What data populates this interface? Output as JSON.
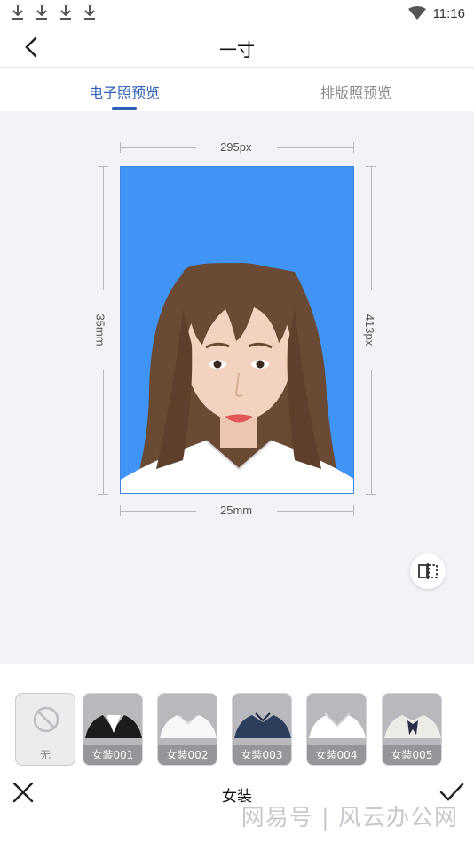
{
  "status_bar": {
    "time": "11:16",
    "download_icons": [
      "download-icon",
      "download-icon",
      "download-icon",
      "download-icon"
    ],
    "wifi_icon": "wifi-icon"
  },
  "header": {
    "title": "一寸",
    "back_icon": "chevron-left-icon"
  },
  "tabs": [
    {
      "label": "电子照预览",
      "active": true
    },
    {
      "label": "排版照预览",
      "active": false
    }
  ],
  "preview": {
    "width_px_label": "295px",
    "height_px_label": "413px",
    "width_mm_label": "25mm",
    "height_mm_label": "35mm",
    "background_color": "#3f94f6",
    "compare_icon": "split-compare-icon"
  },
  "outfits": [
    {
      "label": "无",
      "icon": "no-entry-icon",
      "selected": true
    },
    {
      "label": "女装001",
      "icon": "black-suit-icon"
    },
    {
      "label": "女装002",
      "icon": "white-shirt-icon"
    },
    {
      "label": "女装003",
      "icon": "navy-shirt-icon"
    },
    {
      "label": "女装004",
      "icon": "white-blouse-icon"
    },
    {
      "label": "女装005",
      "icon": "bow-tie-blouse-icon"
    }
  ],
  "bottom_bar": {
    "title": "女装",
    "cancel_icon": "close-icon",
    "confirm_icon": "check-icon",
    "watermark": "网易号 | 风云办公网"
  },
  "colors": {
    "accent": "#2f5fb8",
    "photo_bg": "#3f94f6",
    "preview_bg": "#f2f3f7"
  }
}
